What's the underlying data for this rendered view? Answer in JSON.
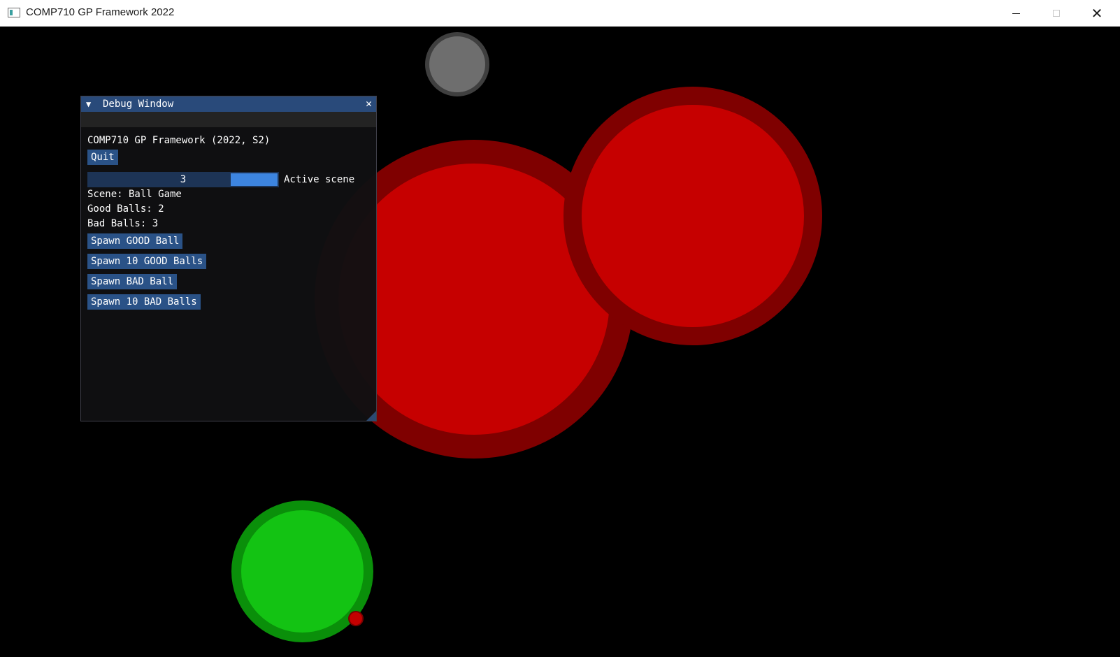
{
  "window": {
    "title": "COMP710 GP Framework 2022",
    "minimize_icon": "minimize-icon",
    "maximize_icon": "maximize-icon",
    "close_icon": "close-icon"
  },
  "debug_window": {
    "title": "Debug Window",
    "collapse_glyph": "▼",
    "close_glyph": "✕",
    "heading": "COMP710 GP Framework (2022, S2)",
    "quit_label": "Quit",
    "scene_slider": {
      "value": "3",
      "label": "Active scene"
    },
    "scene_text": "Scene: Ball Game",
    "good_balls_text": "Good Balls: 2",
    "bad_balls_text": "Bad Balls: 3",
    "buttons": {
      "spawn_good": "Spawn GOOD Ball",
      "spawn_10_good": "Spawn 10 GOOD Balls",
      "spawn_bad": "Spawn BAD Ball",
      "spawn_10_bad": "Spawn 10 BAD Balls"
    }
  },
  "colors": {
    "background": "#000000",
    "good_ball": "#13c313",
    "bad_ball": "#c60000",
    "neutral_ball": "#6e6e6e",
    "imgui_title": "#294a7a",
    "imgui_button": "#2a5287"
  }
}
